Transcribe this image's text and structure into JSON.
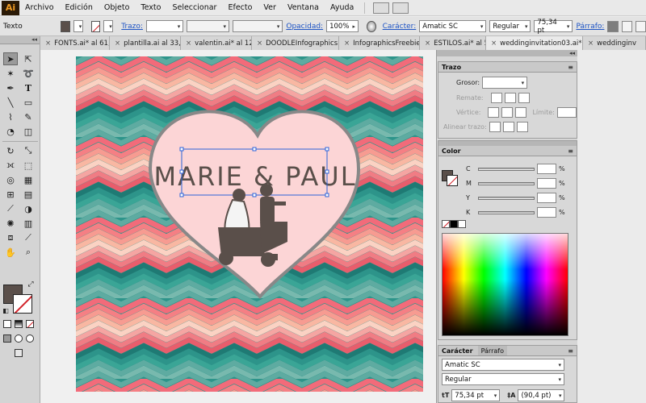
{
  "app": {
    "logo_text": "Ai"
  },
  "menu": [
    "Archivo",
    "Edición",
    "Objeto",
    "Texto",
    "Seleccionar",
    "Efecto",
    "Ver",
    "Ventana",
    "Ayuda"
  ],
  "control": {
    "mode": "Texto",
    "trazo_label": "Trazo:",
    "opacidad_label": "Opacidad:",
    "opacidad_value": "100%",
    "caracter_label": "Carácter:",
    "font_family": "Amatic SC",
    "font_style": "Regular",
    "font_size": "75,34 pt",
    "parrafo_label": "Párrafo:"
  },
  "tabs": [
    "FONTS.ai* al 61,...",
    "plantilla.ai al 33,...",
    "valentin.ai* al 12...",
    "DOODLEInfographics.ai",
    "InfographicsFreebie.ai",
    "ESTILOS.ai* al 50...",
    "weddinginvitation03.ai*",
    "weddinginv"
  ],
  "artwork": {
    "title": "MARIE & PAUL",
    "colors": {
      "pink": "#fcd5d6",
      "outline": "#888888",
      "ink": "#5a4f4a"
    }
  },
  "trazo_panel": {
    "title": "Trazo",
    "grosor_label": "Grosor:",
    "remate_label": "Remate:",
    "vertice_label": "Vértice:",
    "limite_label": "Límite:",
    "limite_unit": "x",
    "alinear_label": "Alinear trazo:"
  },
  "color_panel": {
    "title": "Color",
    "channels": [
      "C",
      "M",
      "Y",
      "K"
    ],
    "unit": "%"
  },
  "caracter_panel": {
    "title": "Carácter",
    "tab2": "Párrafo",
    "font_family": "Amatic SC",
    "font_style": "Regular",
    "size": "75,34 pt",
    "leading": "(90,4 pt)"
  }
}
